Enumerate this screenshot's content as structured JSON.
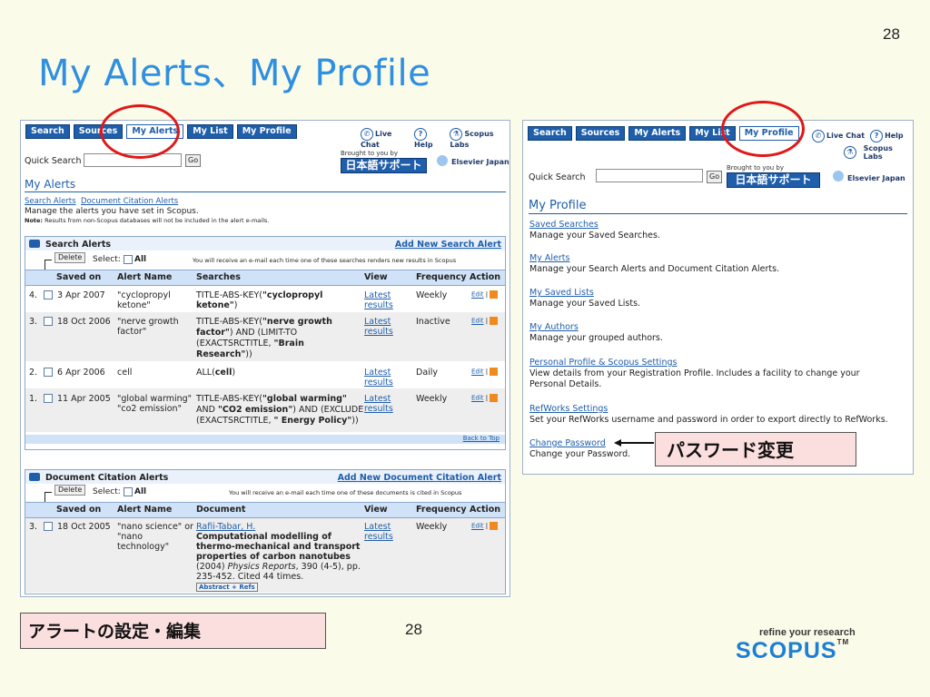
{
  "slide_number": "28",
  "title": "My Alerts、My Profile",
  "left": {
    "nav": [
      "Search",
      "Sources",
      "My Alerts",
      "My List",
      "My Profile"
    ],
    "toolinks": [
      "Live Chat",
      "Help",
      "Scopus Labs"
    ],
    "quick_search_label": "Quick Search",
    "go": "Go",
    "brought": "Brought to you by",
    "jp_support": "日本語サポート",
    "elsevier": "Elsevier Japan",
    "page_heading": "My Alerts",
    "sublink1": "Search Alerts",
    "sublink2": "Document Citation Alerts",
    "manage_text": "Manage the alerts you have set in Scopus.",
    "note_label": "Note:",
    "note_text": "Results from non-Scopus databases will not be included in the alert e-mails.",
    "search_alerts": {
      "title": "Search Alerts",
      "add_link": "Add New Search Alert",
      "delete": "Delete",
      "select": "Select:",
      "all": "All",
      "info": "You will receive an e-mail each time one of these searches renders new results in Scopus",
      "headers": [
        "Saved on",
        "Alert Name",
        "Searches",
        "View",
        "Frequency",
        "Action"
      ],
      "rows": [
        {
          "num": "4.",
          "saved": "3 Apr 2007",
          "name1": "\"cyclopropyl",
          "name2": "ketone\"",
          "s1a": "TITLE-ABS-KEY(",
          "s1b": "\"cyclopropyl",
          "s2a": "ketone\"",
          "s2b": ")",
          "view1": "Latest",
          "view2": "results",
          "freq": "Weekly"
        },
        {
          "num": "3.",
          "saved": "18 Oct 2006",
          "name1": "\"nerve growth",
          "name2": "factor\"",
          "s1a": "TITLE-ABS-KEY(",
          "s1b": "\"nerve growth",
          "s2a": "factor\"",
          "s2b": ") AND (LIMIT-TO",
          "s3": "(EXACTSRCTITLE, ",
          "s3b": "\"Brain",
          "s4": "Research\"",
          "s4b": "))",
          "view1": "Latest",
          "view2": "results",
          "freq": "Inactive"
        },
        {
          "num": "2.",
          "saved": "6 Apr 2006",
          "name1": "cell",
          "s1a": "ALL(",
          "s1b": "cell",
          "s1c": ")",
          "view1": "Latest",
          "view2": "results",
          "freq": "Daily"
        },
        {
          "num": "1.",
          "saved": "11 Apr 2005",
          "name1": "\"global warming\"",
          "name2": "\"co2 emission\"",
          "s1a": "TITLE-ABS-KEY(",
          "s1b": "\"global warming\"",
          "s2a": "AND ",
          "s2b": "\"CO2 emission\"",
          "s2c": ") AND (EXCLUDE",
          "s3": "(EXACTSRCTITLE, ",
          "s3b": "\" Energy Policy\"",
          "s3c": "))",
          "view1": "Latest",
          "view2": "results",
          "freq": "Weekly"
        }
      ],
      "edit": "Edit",
      "sep": "|",
      "back_to_top": "Back to Top"
    },
    "doc_alerts": {
      "title": "Document Citation Alerts",
      "add_link": "Add New Document Citation Alert",
      "delete": "Delete",
      "select": "Select:",
      "all": "All",
      "info": "You will receive an e-mail each time one of these documents is cited in Scopus",
      "headers": [
        "Saved on",
        "Alert Name",
        "Document",
        "View",
        "Frequency",
        "Action"
      ],
      "row": {
        "num": "3.",
        "saved": "18 Oct 2005",
        "name1": "\"nano science\" or",
        "name2": "\"nano",
        "name3": "technology\"",
        "author": "Rafii-Tabar, H.",
        "doc1": "Computational modelling of",
        "doc2": "thermo-mechanical and transport",
        "doc3": "properties of carbon nanotubes",
        "doc4a": "(2004) ",
        "doc4b": "Physics Reports",
        "doc4c": ", 390 (4-5), pp.",
        "doc5": "235-452. Cited 44 times.",
        "abstract": "Abstract + Refs",
        "view1": "Latest",
        "view2": "results",
        "freq": "Weekly"
      },
      "edit": "Edit",
      "sep": "|"
    }
  },
  "right": {
    "nav": [
      "Search",
      "Sources",
      "My Alerts",
      "My List",
      "My Profile"
    ],
    "toolinks": [
      "Live Chat",
      "Help",
      "Scopus Labs"
    ],
    "quick_search_label": "Quick Search",
    "go": "Go",
    "brought": "Brought to you by",
    "jp_support": "日本語サポート",
    "elsevier": "Elsevier Japan",
    "page_heading": "My Profile",
    "items": [
      {
        "link": "Saved Searches",
        "desc": "Manage your Saved Searches."
      },
      {
        "link": "My Alerts",
        "desc": "Manage your Search Alerts and Document Citation Alerts."
      },
      {
        "link": "My Saved Lists",
        "desc": "Manage your Saved Lists."
      },
      {
        "link": "My Authors",
        "desc": "Manage your grouped authors."
      },
      {
        "link": "Personal Profile & Scopus Settings",
        "desc": "View details from your Registration Profile. Includes a facility to change your",
        "desc2": "Personal Details."
      },
      {
        "link": "RefWorks Settings",
        "desc": "Set your RefWorks username and password in order to export directly to RefWorks."
      },
      {
        "link": "Change Password",
        "desc": "Change your Password."
      }
    ]
  },
  "password_callout": "パスワード変更",
  "bottom_callout": "アラートの設定・編集",
  "bottom_number": "28",
  "tagline": "refine your research",
  "scopus_logo": "SCOPUS",
  "trademark": "TM",
  "colors": {
    "title": "#2f8fe0",
    "nav": "#1f5eaa",
    "highlight": "#e01818",
    "callout_bg": "#fbdede"
  }
}
